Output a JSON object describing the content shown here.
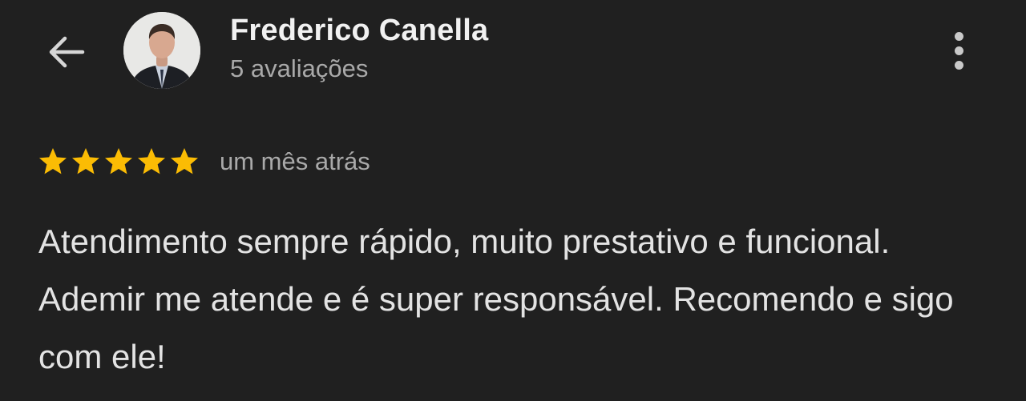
{
  "header": {
    "back_icon": "arrow-left-icon",
    "avatar_icon": "reviewer-avatar",
    "reviewer_name": "Frederico Canella",
    "review_count": "5 avaliações",
    "more_icon": "more-vertical-icon"
  },
  "review": {
    "rating": 5,
    "rating_max": 5,
    "time_ago": "um mês atrás",
    "text": "Atendimento sempre rápido, muito prestativo e funcional. Ademir me atende e é super responsável. Recomendo e sigo com ele!"
  },
  "colors": {
    "background": "#202020",
    "star": "#FBBC04",
    "name": "#F1F1F1",
    "secondary_text": "#A9A9A9",
    "body_text": "#E3E3E3"
  }
}
